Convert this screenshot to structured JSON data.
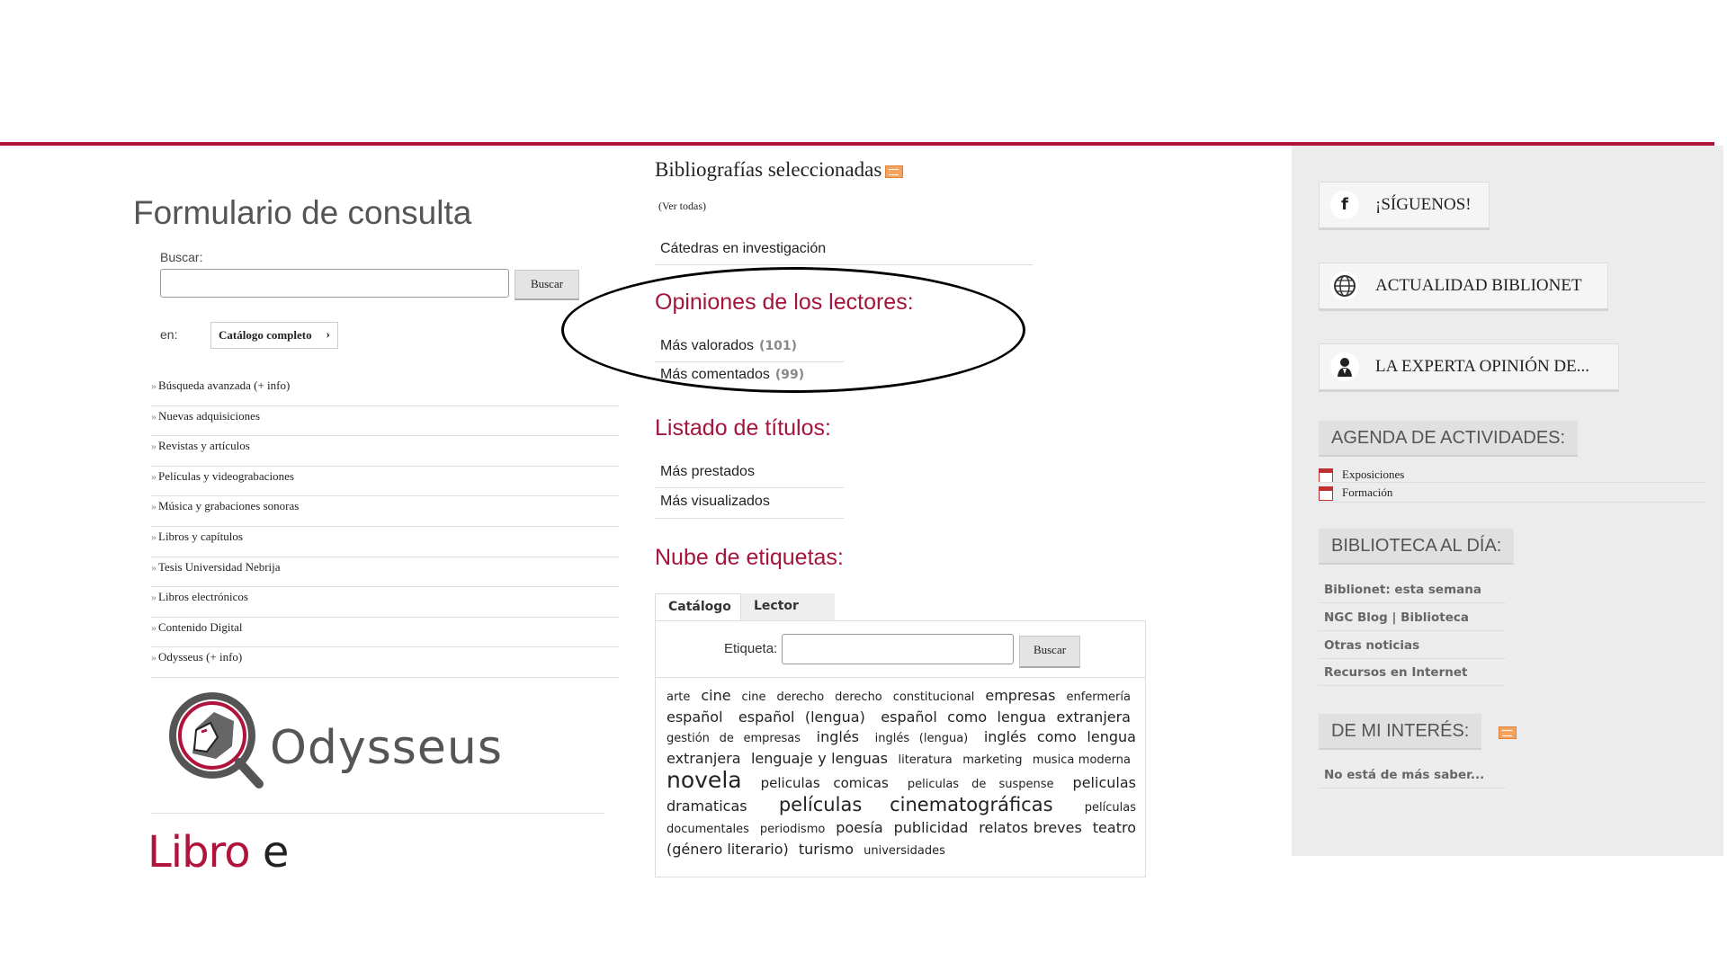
{
  "left": {
    "title": "Formulario de consulta",
    "search_label": "Buscar:",
    "search_button": "Buscar",
    "en_label": "en:",
    "catalog_select": "Catálogo completo",
    "links": [
      "Búsqueda avanzada (+ info)",
      "Nuevas adquisiciones",
      "Revistas y artículos",
      "Películas y videograbaciones",
      "Música y grabaciones sonoras",
      "Libros y capítulos",
      "Tesis Universidad Nebrija",
      "Libros electrónicos",
      "Contenido Digital",
      "Odysseus (+ info)"
    ],
    "odysseus_logo_text": "Odysseus",
    "libro_text": "Libro",
    "libro_e": "e"
  },
  "middle": {
    "biblio_title": "Bibliografías seleccionadas",
    "ver_todas": "(Ver todas)",
    "catedras": "Cátedras en investigación",
    "opiniones_title": "Opiniones de los lectores:",
    "mas_valorados": "Más valorados",
    "mas_valorados_count": "(101)",
    "mas_comentados": "Más comentados",
    "mas_comentados_count": "(99)",
    "listado_title": "Listado de títulos:",
    "mas_prestados": "Más prestados",
    "mas_visualizados": "Más visualizados",
    "nube_title": "Nube de etiquetas:",
    "tab_catalogo": "Catálogo",
    "tab_lector": "Lector",
    "etiqueta_label": "Etiqueta:",
    "etiqueta_button": "Buscar",
    "tags": [
      {
        "text": "arte",
        "size": 1
      },
      {
        "text": "cine",
        "size": 3
      },
      {
        "text": "cine",
        "size": 1
      },
      {
        "text": "derecho",
        "size": 1
      },
      {
        "text": "derecho",
        "size": 1
      },
      {
        "text": "constitucional",
        "size": 1
      },
      {
        "text": "empresas",
        "size": 3
      },
      {
        "text": "enfermería",
        "size": 1
      },
      {
        "text": "español",
        "size": 3
      },
      {
        "text": "español (lengua)",
        "size": 3
      },
      {
        "text": "español como lengua extranjera",
        "size": 3
      },
      {
        "text": "gestión de empresas",
        "size": 1
      },
      {
        "text": "inglés",
        "size": 3
      },
      {
        "text": "inglés (lengua)",
        "size": 1
      },
      {
        "text": "inglés como lengua extranjera",
        "size": 3
      },
      {
        "text": "lenguaje y lenguas",
        "size": 3
      },
      {
        "text": "literatura",
        "size": 1
      },
      {
        "text": "marketing",
        "size": 1
      },
      {
        "text": "musica moderna",
        "size": 1
      },
      {
        "text": "novela",
        "size": 5
      },
      {
        "text": "peliculas comicas",
        "size": 2
      },
      {
        "text": "peliculas de suspense",
        "size": 1
      },
      {
        "text": "peliculas dramaticas",
        "size": 3
      },
      {
        "text": "películas cinematográficas",
        "size": 4
      },
      {
        "text": "películas documentales",
        "size": 1
      },
      {
        "text": "periodismo",
        "size": 1
      },
      {
        "text": "poesía",
        "size": 3
      },
      {
        "text": "publicidad",
        "size": 3
      },
      {
        "text": "relatos breves",
        "size": 3
      },
      {
        "text": "teatro (género literario)",
        "size": 3
      },
      {
        "text": "turismo",
        "size": 3
      },
      {
        "text": "universidades",
        "size": 1
      }
    ]
  },
  "right": {
    "siguenos": "¡SÍGUENOS!",
    "actualidad": "ACTUALIDAD BIBLIONET",
    "experta": "LA EXPERTA OPINIÓN DE...",
    "agenda_title": "AGENDA DE ACTIVIDADES:",
    "agenda_items": [
      "Exposiciones",
      "Formación"
    ],
    "biblioteca_title": "BIBLIOTECA AL DÍA:",
    "news": [
      "Biblionet: esta semana",
      "NGC Blog | Biblioteca",
      "Otras noticias",
      "Recursos en Internet"
    ],
    "interes_title": "DE MI INTERÉS:",
    "interes_item": "No está de más saber..."
  },
  "colors": {
    "accent": "#a4153d",
    "top_line": "#b0143c",
    "sidebar_bg": "#ececec"
  },
  "icons": {
    "siguenos": "facebook-icon",
    "actualidad": "globe-icon",
    "experta": "person-icon",
    "agenda": "calendar-icon",
    "rss": "rss-icon"
  }
}
